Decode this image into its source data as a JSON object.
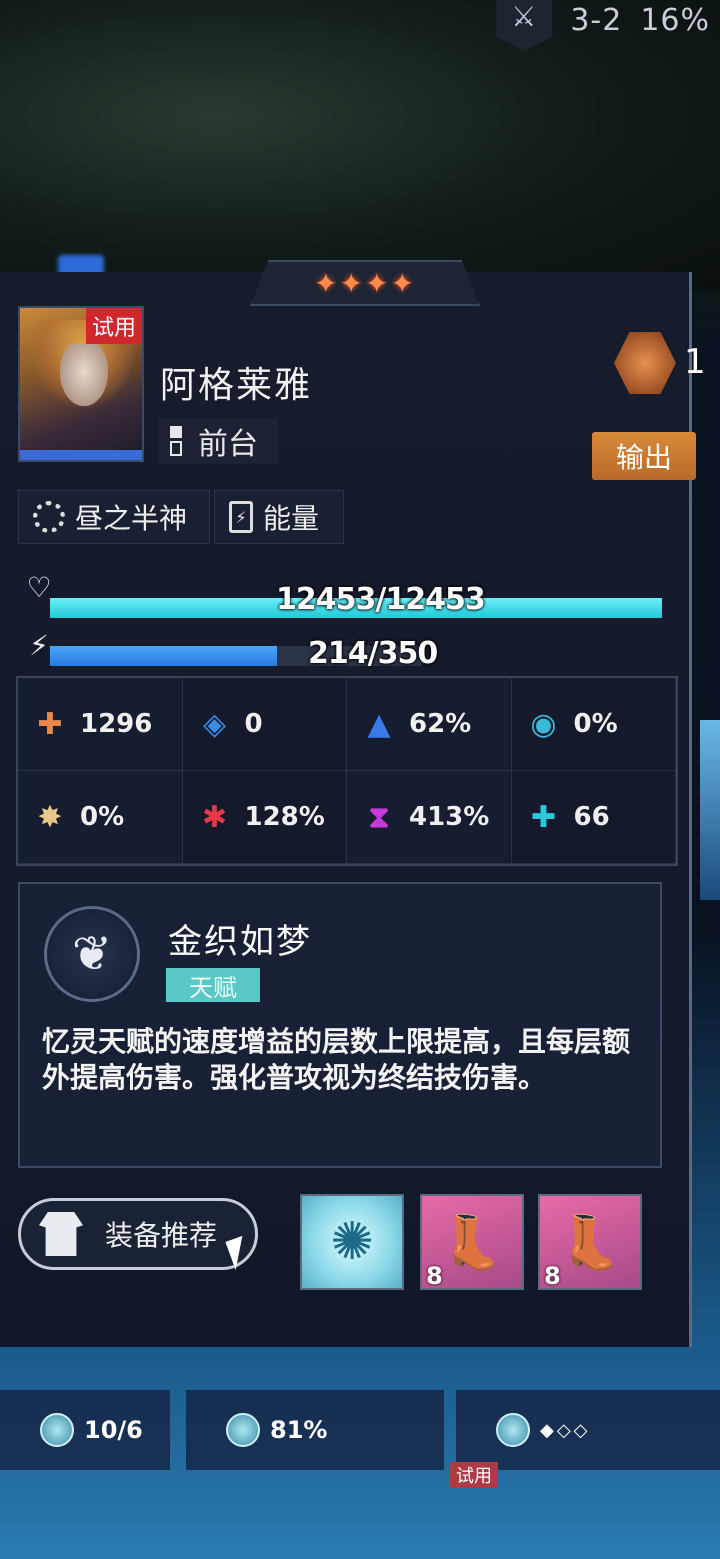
{
  "hud": {
    "stage": "3-2",
    "percent": "16%"
  },
  "character": {
    "rarity_stars": "✦✦✦✦",
    "trial_tag": "试用",
    "name": "阿格莱雅",
    "position": "前台",
    "rank": "1",
    "role": "输出",
    "path": "昼之半神",
    "energy_type": "能量"
  },
  "bars": {
    "hp": {
      "text": "12453/12453",
      "fill": 1.0
    },
    "energy": {
      "text": "214/350",
      "fill": 0.611
    }
  },
  "stats": [
    {
      "icon": "attack-icon",
      "value": "1296",
      "color": "#e8884a"
    },
    {
      "icon": "defense-icon",
      "value": "0",
      "color": "#3a8ae8"
    },
    {
      "icon": "crit-rate-icon",
      "value": "62%",
      "color": "#3a7ae8"
    },
    {
      "icon": "effect-res-icon",
      "value": "0%",
      "color": "#3ab8d8"
    },
    {
      "icon": "break-effect-icon",
      "value": "0%",
      "color": "#e8c88a"
    },
    {
      "icon": "crit-dmg-icon",
      "value": "128%",
      "color": "#e8384a"
    },
    {
      "icon": "speed-boost-icon",
      "value": "413%",
      "color": "#c83ad8"
    },
    {
      "icon": "healing-icon",
      "value": "66",
      "color": "#2ac8d8"
    }
  ],
  "talent": {
    "name": "金织如梦",
    "type": "天赋",
    "description": "忆灵天赋的速度增益的层数上限提高，且每层额外提高伤害。强化普攻视为终结技伤害。"
  },
  "buttons": {
    "recommend": "装备推荐"
  },
  "equipment": [
    {
      "icon": "light-cone-icon",
      "level": ""
    },
    {
      "icon": "relic-boots-icon",
      "level": "8"
    },
    {
      "icon": "relic-boots-icon",
      "level": "8"
    }
  ],
  "team": [
    {
      "stat": "10/6"
    },
    {
      "stat": "81%"
    },
    {
      "stat": "◆◇◇",
      "trial": "试用"
    }
  ]
}
